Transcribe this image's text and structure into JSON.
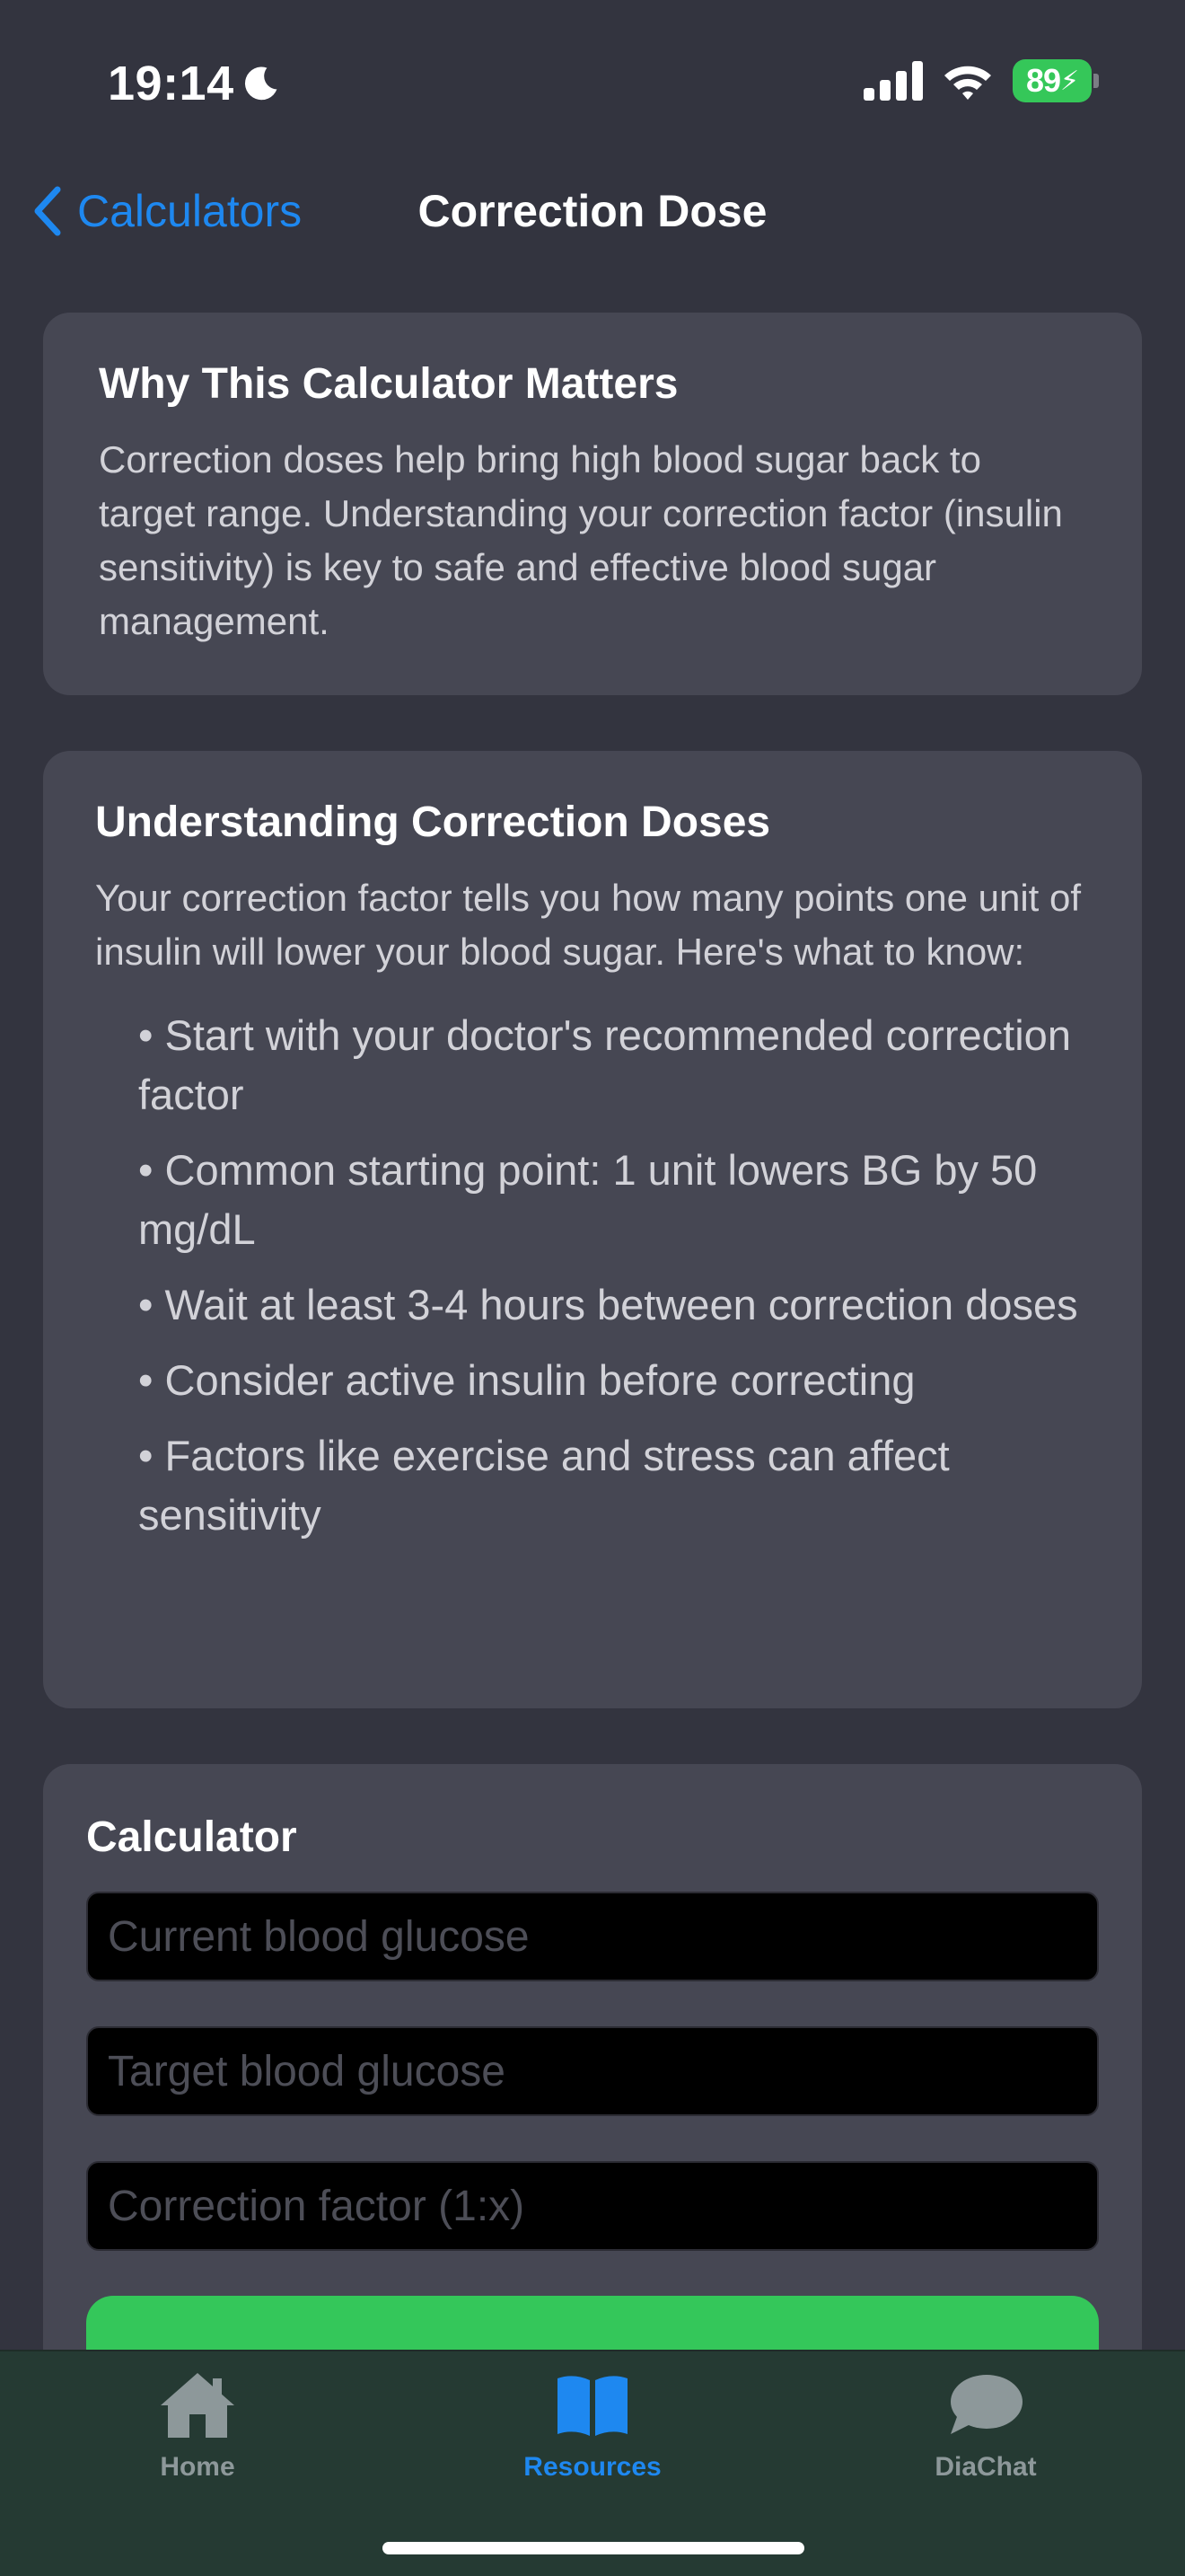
{
  "status_bar": {
    "time": "19:14",
    "battery": "89"
  },
  "nav": {
    "back_label": "Calculators",
    "title": "Correction Dose"
  },
  "intro_card": {
    "title": "Why This Calculator Matters",
    "body": "Correction doses help bring high blood sugar back to target range. Understanding your correction factor (insulin sensitivity) is key to safe and effective blood sugar management."
  },
  "info_card": {
    "title": "Understanding Correction Doses",
    "body": "Your correction factor tells you how many points one unit of insulin will lower your blood sugar. Here's what to know:",
    "bullets": [
      "• Start with your doctor's recommended correction factor",
      "• Common starting point: 1 unit lowers BG by 50 mg/dL",
      "• Wait at least 3-4 hours between correction doses",
      "• Consider active insulin before correcting",
      "• Factors like exercise and stress can affect sensitivity"
    ]
  },
  "calculator": {
    "title": "Calculator",
    "current_bg_placeholder": "Current blood glucose",
    "target_bg_placeholder": "Target blood glucose",
    "correction_factor_placeholder": "Correction factor (1:x)",
    "button_color": "#34c75a"
  },
  "tab_bar": {
    "tabs": [
      {
        "label": "Home",
        "icon": "house-icon"
      },
      {
        "label": "Resources",
        "icon": "book-icon",
        "active": true
      },
      {
        "label": "DiaChat",
        "icon": "chat-bubble-icon"
      }
    ],
    "active_color": "#1e88f0"
  }
}
